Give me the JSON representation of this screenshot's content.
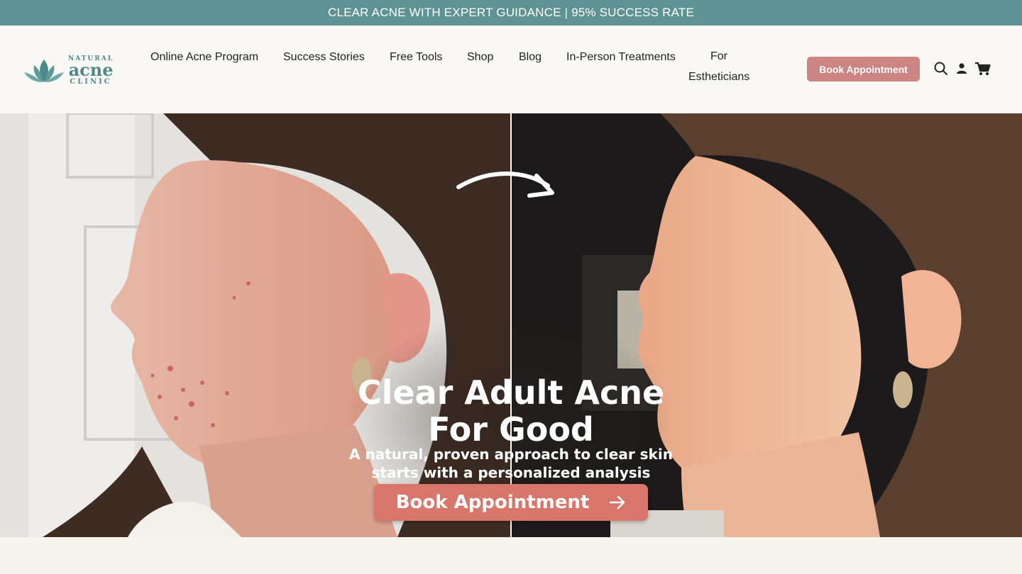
{
  "announcement": "CLEAR ACNE WITH EXPERT GUIDANCE | 95% SUCCESS RATE",
  "logo": {
    "natural": "NATURAL",
    "acne": "acne",
    "clinic": "CLINIC"
  },
  "nav": {
    "items": [
      {
        "label": "Online Acne Program"
      },
      {
        "label": "Success Stories"
      },
      {
        "label": "Free Tools"
      },
      {
        "label": "Shop"
      },
      {
        "label": "Blog"
      },
      {
        "label": "In-Person Treatments"
      },
      {
        "label_line1": "For",
        "label_line2": "Estheticians"
      }
    ]
  },
  "header_cta": "Book Appointment",
  "icons": [
    "search-icon",
    "account-icon",
    "cart-icon"
  ],
  "hero": {
    "title_line1": "Clear Adult Acne",
    "title_line2": "For Good",
    "subtitle_line1": "A natural, proven approach to clear skin",
    "subtitle_line2": "starts with a personalized analysis",
    "cta": "Book Appointment",
    "cta_icon": "arrow-right-icon"
  },
  "colors": {
    "announcement_bg": "#5f9393",
    "brand_teal": "#4f8a8a",
    "header_button": "#cc8582",
    "hero_button": "#d9766b"
  }
}
